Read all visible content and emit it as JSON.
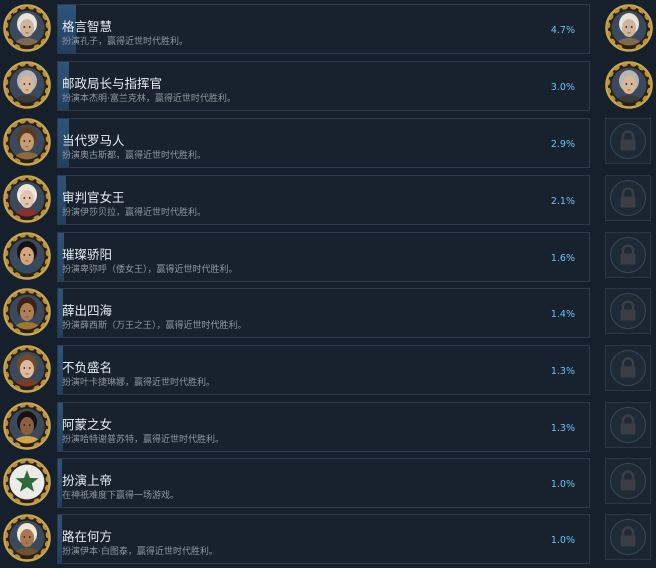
{
  "achievements": [
    {
      "title": "格言智慧",
      "desc": "扮演孔子，赢得近世时代胜利。",
      "percent_text": "4.7%",
      "percent": 4.7,
      "unlocked": true,
      "portrait": "sage-portrait-icon"
    },
    {
      "title": "邮政局长与指挥官",
      "desc": "扮演本杰明·富兰克林，赢得近世时代胜利。",
      "percent_text": "3.0%",
      "percent": 3.0,
      "unlocked": true,
      "portrait": "statesman-portrait-icon"
    },
    {
      "title": "当代罗马人",
      "desc": "扮演奥古斯都，赢得近世时代胜利。",
      "percent_text": "2.9%",
      "percent": 2.9,
      "unlocked": false,
      "portrait": "emperor-portrait-icon"
    },
    {
      "title": "审判官女王",
      "desc": "扮演伊莎贝拉，赢得近世时代胜利。",
      "percent_text": "2.1%",
      "percent": 2.1,
      "unlocked": false,
      "portrait": "queen-portrait-icon"
    },
    {
      "title": "璀璨骄阳",
      "desc": "扮演卑弥呼（倭女王），赢得近世时代胜利。",
      "percent_text": "1.6%",
      "percent": 1.6,
      "unlocked": false,
      "portrait": "priestess-portrait-icon"
    },
    {
      "title": "薛出四海",
      "desc": "扮演薛西斯（万王之王），赢得近世时代胜利。",
      "percent_text": "1.4%",
      "percent": 1.4,
      "unlocked": false,
      "portrait": "king-portrait-icon"
    },
    {
      "title": "不负盛名",
      "desc": "扮演叶卡捷琳娜，赢得近世时代胜利。",
      "percent_text": "1.3%",
      "percent": 1.3,
      "unlocked": false,
      "portrait": "empress-portrait-icon"
    },
    {
      "title": "阿蒙之女",
      "desc": "扮演哈特谢普苏特，赢得近世时代胜利。",
      "percent_text": "1.3%",
      "percent": 1.3,
      "unlocked": false,
      "portrait": "pharaoh-portrait-icon"
    },
    {
      "title": "扮演上帝",
      "desc": "在神祇难度下赢得一场游戏。",
      "percent_text": "1.0%",
      "percent": 1.0,
      "unlocked": false,
      "portrait": "star-emblem-icon"
    },
    {
      "title": "路在何方",
      "desc": "扮演伊本·白图泰，赢得近世时代胜利。",
      "percent_text": "1.0%",
      "percent": 1.0,
      "unlocked": false,
      "portrait": "traveler-portrait-icon"
    }
  ],
  "colors": {
    "background": "#16202d",
    "bar": "#2f5479",
    "percent": "#67c1f5",
    "gold": "#c9a74a"
  }
}
